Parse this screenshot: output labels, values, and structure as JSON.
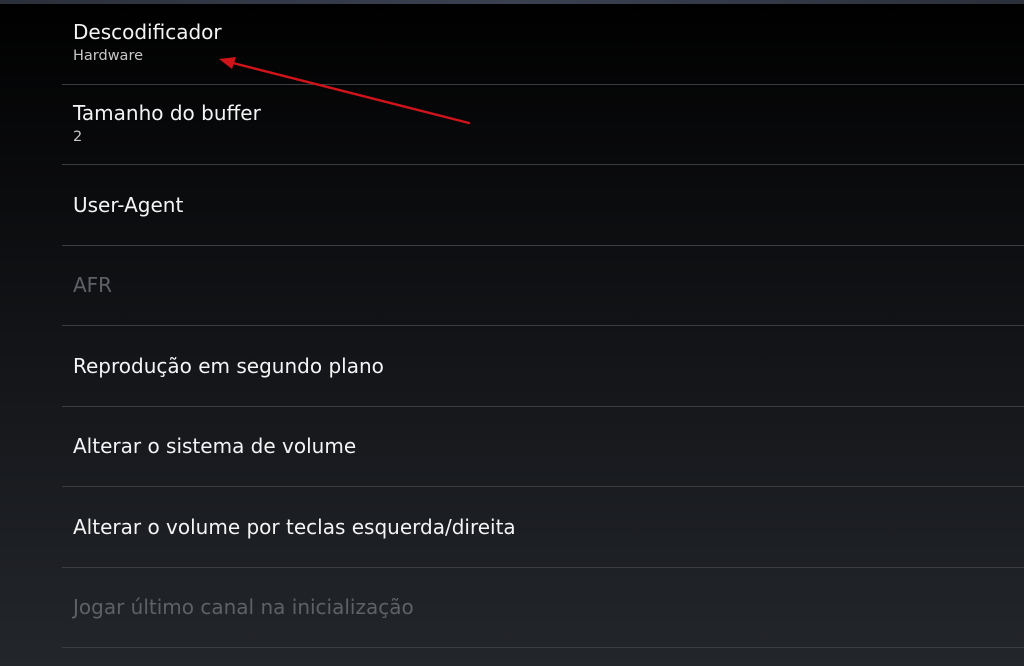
{
  "settings": {
    "items": [
      {
        "title": "Descodificador",
        "summary": "Hardware",
        "enabled": true
      },
      {
        "title": "Tamanho do buffer",
        "summary": "2",
        "enabled": true
      },
      {
        "title": "User-Agent",
        "summary": "",
        "enabled": true
      },
      {
        "title": "AFR",
        "summary": "",
        "enabled": false
      },
      {
        "title": "Reprodução em segundo plano",
        "summary": "",
        "enabled": true
      },
      {
        "title": "Alterar o sistema de volume",
        "summary": "",
        "enabled": true
      },
      {
        "title": "Alterar o volume por teclas esquerda/direita",
        "summary": "",
        "enabled": true
      },
      {
        "title": "Jogar último canal na inicialização",
        "summary": "",
        "enabled": false
      }
    ]
  },
  "annotation": {
    "color": "#d0141a"
  }
}
